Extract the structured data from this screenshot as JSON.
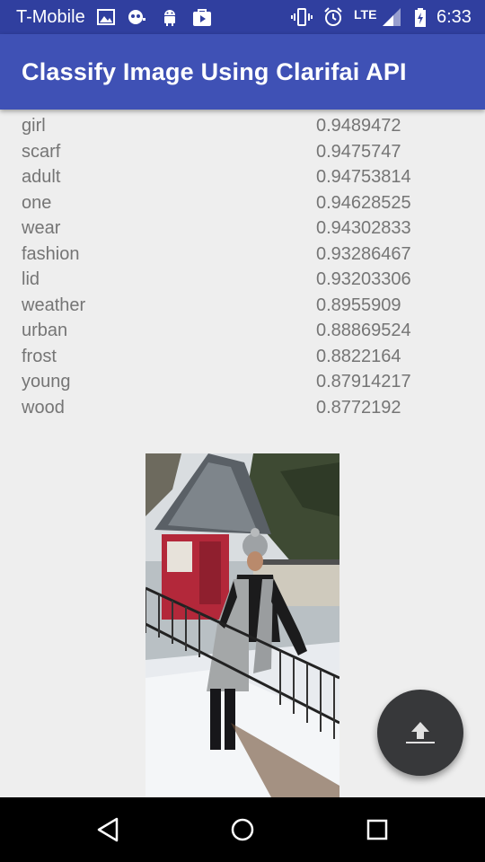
{
  "status_bar": {
    "carrier": "T-Mobile",
    "network": "LTE",
    "time": "6:33",
    "icons": [
      "image-icon",
      "clock-face-icon",
      "android-icon",
      "play-store-icon",
      "vibrate-icon",
      "alarm-icon",
      "signal-icon",
      "battery-charging-icon"
    ]
  },
  "app_bar": {
    "title": "Classify Image Using Clarifai API"
  },
  "results": [
    {
      "label": "girl",
      "score": "0.9489472"
    },
    {
      "label": "scarf",
      "score": "0.9475747"
    },
    {
      "label": "adult",
      "score": "0.94753814"
    },
    {
      "label": "one",
      "score": "0.94628525"
    },
    {
      "label": "wear",
      "score": "0.94302833"
    },
    {
      "label": "fashion",
      "score": "0.93286467"
    },
    {
      "label": "lid",
      "score": "0.93203306"
    },
    {
      "label": "weather",
      "score": "0.8955909"
    },
    {
      "label": "urban",
      "score": "0.88869524"
    },
    {
      "label": "frost",
      "score": "0.8822164"
    },
    {
      "label": "young",
      "score": "0.87914217"
    },
    {
      "label": "wood",
      "score": "0.8772192"
    }
  ],
  "fab": {
    "icon": "upload-icon"
  },
  "nav_bar": {
    "icons": [
      "back-icon",
      "home-icon",
      "recents-icon"
    ]
  },
  "colors": {
    "status_bar": "#303f9f",
    "app_bar": "#3f51b5",
    "fab": "#37383a",
    "text": "#757575"
  }
}
